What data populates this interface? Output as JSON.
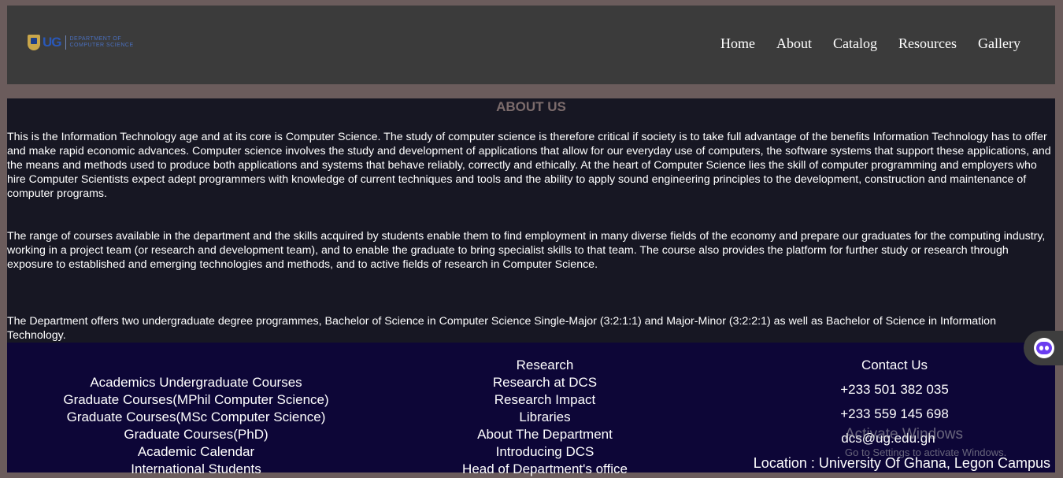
{
  "header": {
    "logo": {
      "abbr": "UG",
      "dept_line1": "DEPARTMENT OF",
      "dept_line2": "COMPUTER SCIENCE"
    },
    "nav": [
      "Home",
      "About",
      "Catalog",
      "Resources",
      "Gallery"
    ]
  },
  "about": {
    "title": "ABOUT US",
    "paragraphs": [
      "This is the Information Technology age and at its core is Computer Science. The study of computer science is therefore critical if society is to take full advantage of the benefits Information Technology has to offer and make rapid economic advances. Computer science involves the study and development of applications that allow for our everyday use of computers, the software systems that support these applications, and the means and methods used to produce both applications and systems that behave reliably, correctly and ethically. At the heart of Computer Science lies the skill of computer programming and employers who hire Computer Scientists expect adept programmers with knowledge of current techniques and tools and the ability to apply sound engineering principles to the development, construction and maintenance of computer programs.",
      "The range of courses available in the department and the skills acquired by students enable them to find employment in many diverse fields of the economy and prepare our graduates for the computing industry, working in a project team (or research and development team), and to enable the graduate to bring specialist skills to that team. The course also provides the platform for further study or research through exposure to established and emerging technologies and methods, and to active fields of research in Computer Science.",
      "The Department offers two undergraduate degree programmes, Bachelor of Science in Computer Science Single-Major (3:2:1:1) and Major-Minor (3:2:2:1) as well as Bachelor of Science in Information Technology."
    ]
  },
  "footer": {
    "academics": [
      "Academics Undergraduate Courses",
      "Graduate Courses(MPhil Computer Science)",
      "Graduate Courses(MSc Computer Science)",
      "Graduate Courses(PhD)",
      "Academic Calendar",
      "International Students"
    ],
    "research": [
      "Research",
      "Research at DCS",
      "Research Impact",
      "Libraries",
      "About The Department",
      "Introducing DCS",
      "Head of Department's office"
    ],
    "contact": {
      "title": "Contact Us",
      "phone1": "+233 501 382 035",
      "phone2": "+233 559 145 698",
      "email": "dcs@ug.edu.gh",
      "location": "Location : University Of Ghana, Legon Campus"
    }
  },
  "watermark": {
    "line1": "Activate Windows",
    "line2": "Go to Settings to activate Windows."
  }
}
